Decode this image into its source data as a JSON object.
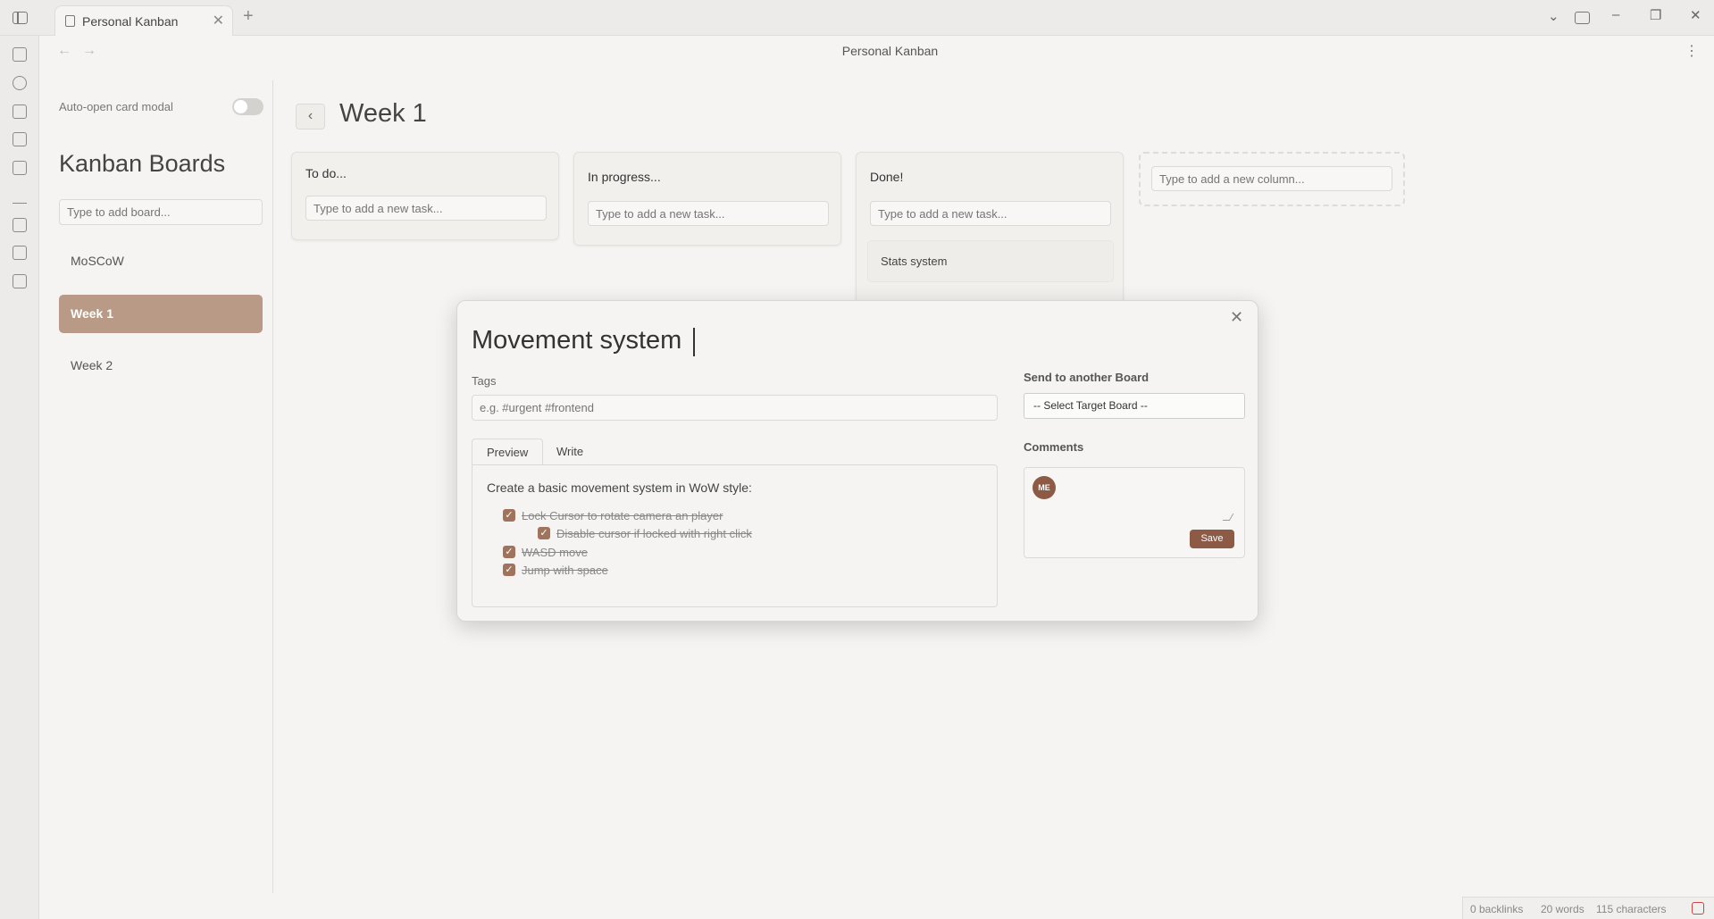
{
  "window": {
    "tab_title": "Personal Kanban",
    "tab_close": "✕",
    "new_tab": "+",
    "doc_title": "Personal Kanban",
    "minimize": "–",
    "restore": "❐",
    "close": "✕",
    "dropdown": "⌄",
    "more": "⋮",
    "back": "←",
    "forward": "→"
  },
  "sidebar": {
    "auto_open_label": "Auto-open card modal",
    "auto_open_enabled": false,
    "heading": "Kanban Boards",
    "board_input_placeholder": "Type to add board...",
    "boards": [
      {
        "label": "MoSCoW",
        "active": false
      },
      {
        "label": "Week 1",
        "active": true
      },
      {
        "label": "Week 2",
        "active": false
      }
    ]
  },
  "board": {
    "back": "‹",
    "title": "Week 1",
    "task_placeholder": "Type to add a new task...",
    "column_placeholder": "Type to add a new column...",
    "columns": [
      {
        "title": "To do...",
        "cards": []
      },
      {
        "title": "In progress...",
        "cards": []
      },
      {
        "title": "Done!",
        "cards": [
          "Stats system"
        ]
      }
    ]
  },
  "modal": {
    "close": "✕",
    "title": "Movement system",
    "tags_label": "Tags",
    "tags_placeholder": "e.g. #urgent #frontend",
    "tabs": [
      "Preview",
      "Write"
    ],
    "active_tab": "Preview",
    "description": "Create a basic movement system in WoW style:",
    "checklist": [
      {
        "text": "Lock Cursor to rotate camera an player",
        "checked": true,
        "level": 0
      },
      {
        "text": "Disable cursor if locked with right click",
        "checked": true,
        "level": 1
      },
      {
        "text": "WASD move",
        "checked": true,
        "level": 0
      },
      {
        "text": "Jump with space",
        "checked": true,
        "level": 0
      }
    ],
    "check_mark": "✓",
    "send_label": "Send to another Board",
    "select_value": "-- Select Target Board --",
    "comments_label": "Comments",
    "avatar_initials": "ME",
    "save_label": "Save"
  },
  "status": {
    "backlinks": "0 backlinks",
    "words": "20 words",
    "characters": "115 characters"
  },
  "colors": {
    "accent": "#8c5a45",
    "active_board": "#b89a86",
    "checkbox": "#a0745c"
  }
}
